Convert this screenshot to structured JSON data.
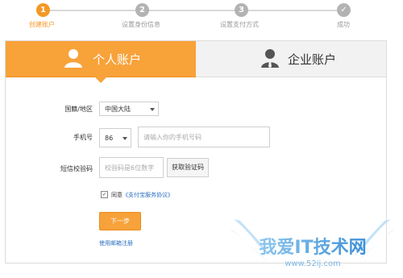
{
  "steps": [
    {
      "number": "1",
      "label": "创建账户"
    },
    {
      "number": "2",
      "label": "设置身份信息"
    },
    {
      "number": "3",
      "label": "设置支付方式"
    },
    {
      "number": "✓",
      "label": "成功"
    }
  ],
  "tabs": {
    "personal": {
      "label": "个人账户"
    },
    "enterprise": {
      "label": "企业账户"
    }
  },
  "form": {
    "region_label": "国籍/地区",
    "region_value": "中国大陆",
    "phone_label": "手机号",
    "phone_code": "86",
    "phone_placeholder": "请输入你的手机号码",
    "sms_label": "短信校验码",
    "sms_placeholder": "校验码是6位数字",
    "get_code_label": "获取验证码",
    "agree_prefix": "同意",
    "agree_link": "《支付宝服务协议》",
    "next_label": "下一步",
    "email_link": "使用邮箱注册"
  },
  "watermark": {
    "title": "我爱IT技术网",
    "url": "www.52ij.com"
  },
  "colors": {
    "accent": "#f39826",
    "link": "#2a6fc0"
  }
}
